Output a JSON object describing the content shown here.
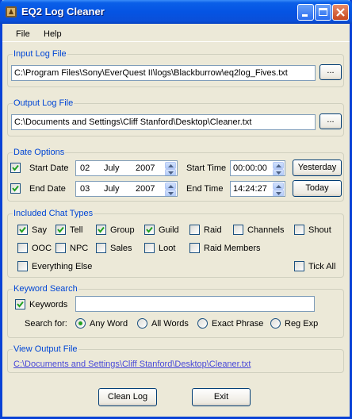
{
  "window": {
    "title": "EQ2 Log Cleaner"
  },
  "menu": {
    "file": "File",
    "help": "Help"
  },
  "input": {
    "label": "Input Log File",
    "path": "C:\\Program Files\\Sony\\EverQuest II\\logs\\Blackburrow\\eq2log_Fives.txt",
    "browse": "..."
  },
  "output": {
    "label": "Output Log File",
    "path": "C:\\Documents and Settings\\Cliff Stanford\\Desktop\\Cleaner.txt",
    "browse": "..."
  },
  "date_options": {
    "label": "Date Options",
    "start": {
      "label": "Start Date",
      "checked": true,
      "day": "02",
      "month": "July",
      "year": "2007",
      "time_label": "Start Time",
      "time": "00:00:00",
      "button": "Yesterday"
    },
    "end": {
      "label": "End Date",
      "checked": true,
      "day": "03",
      "month": "July",
      "year": "2007",
      "time_label": "End Time",
      "time": "14:24:27",
      "button": "Today"
    }
  },
  "chat_types": {
    "label": "Included Chat Types",
    "items": [
      {
        "label": "Say",
        "checked": true
      },
      {
        "label": "Tell",
        "checked": true
      },
      {
        "label": "Group",
        "checked": true
      },
      {
        "label": "Guild",
        "checked": true
      },
      {
        "label": "Raid",
        "checked": false
      },
      {
        "label": "Channels",
        "checked": false
      },
      {
        "label": "Shout",
        "checked": false
      },
      {
        "label": "OOC",
        "checked": false
      },
      {
        "label": "NPC",
        "checked": false
      },
      {
        "label": "Sales",
        "checked": false
      },
      {
        "label": "Loot",
        "checked": false
      },
      {
        "label": "Raid Members",
        "checked": false
      },
      {
        "label": "Everything Else",
        "checked": false
      },
      {
        "label": "Tick All",
        "checked": false
      }
    ]
  },
  "keyword": {
    "label": "Keyword Search",
    "checkbox_label": "Keywords",
    "checked": true,
    "value": "",
    "search_for": "Search for:",
    "options": [
      {
        "label": "Any Word",
        "selected": true
      },
      {
        "label": "All Words",
        "selected": false
      },
      {
        "label": "Exact Phrase",
        "selected": false
      },
      {
        "label": "Reg Exp",
        "selected": false
      }
    ]
  },
  "view_output": {
    "label": "View Output File",
    "link": "C:\\Documents and Settings\\Cliff Stanford\\Desktop\\Cleaner.txt"
  },
  "buttons": {
    "clean": "Clean Log",
    "exit": "Exit"
  },
  "colors": {
    "title_bar": "#0554e3",
    "group_label": "#0046d5",
    "check": "#21a121",
    "link": "#4848d8"
  }
}
